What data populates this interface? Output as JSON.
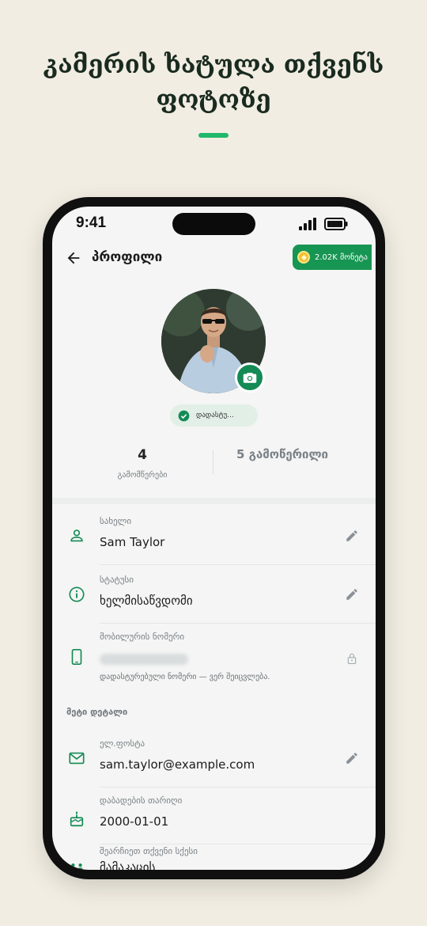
{
  "headline": {
    "line1": "კამერის ხატულა თქვენს",
    "line2": "ფოტოზე",
    "accent_color": "#1fb86a"
  },
  "status_bar": {
    "time": "9:41"
  },
  "app_bar": {
    "title": "პროფილი",
    "coins": "2.02K მონეტა",
    "coins_color": "#179552"
  },
  "profile": {
    "verified_label": "დადასტუ...",
    "stats": {
      "followers_count": "4",
      "followers_label": "გამომწერები",
      "following_label": "5 გამოწერილი"
    }
  },
  "fields": {
    "name": {
      "label": "სახელი",
      "value": "Sam Taylor"
    },
    "status": {
      "label": "სტატუსი",
      "value": "ხელმისაწვდომი"
    },
    "phone": {
      "label": "მობილურის ნომერი",
      "note": "დადასტურებული ნომერი — ვერ შეიცვლება."
    }
  },
  "more_details": {
    "title": "მეტი დეტალი",
    "email": {
      "label": "ელ.ფოსტა",
      "value": "sam.taylor@example.com"
    },
    "birthday": {
      "label": "დაბადების თარიღი",
      "value": "2000-01-01"
    },
    "gender": {
      "label": "შეარჩიეთ თქვენი სქესი",
      "value": "მამაკაცის"
    }
  },
  "colors": {
    "primary": "#148a55",
    "background": "#f1ede2",
    "screen": "#f4f5f4"
  }
}
